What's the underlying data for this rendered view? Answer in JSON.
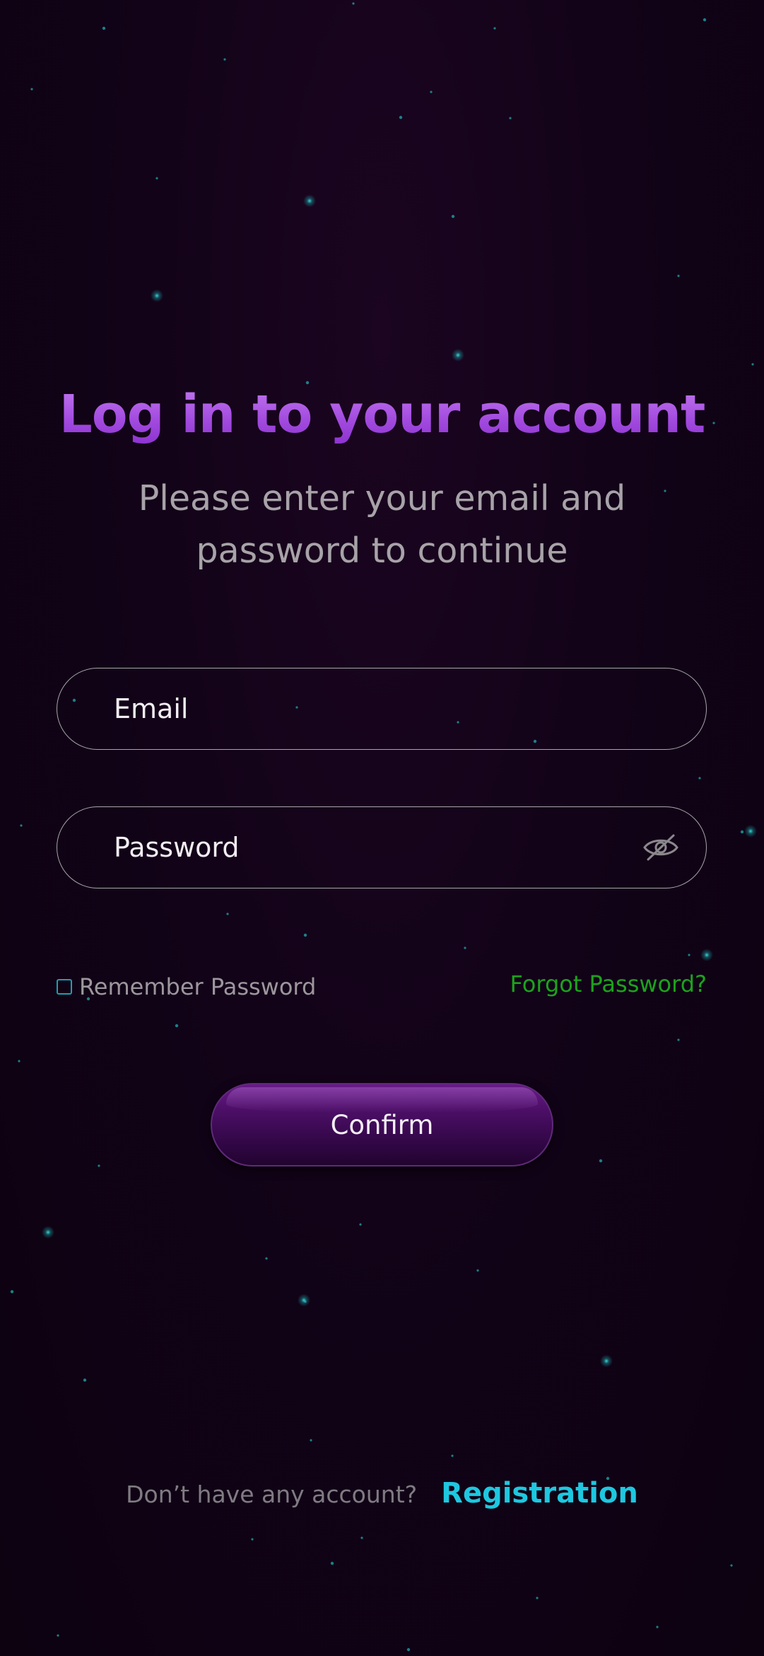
{
  "login": {
    "title": "Log in to your account",
    "subtitle": "Please enter your email and password to continue",
    "email_placeholder": "Email",
    "password_placeholder": "Password",
    "password_toggle_icon": "eye-off-icon",
    "remember_label": "Remember Password",
    "remember_checked": false,
    "forgot_label": "Forgot Password?",
    "confirm_label": "Confirm",
    "footer_prompt": "Don’t have any account?",
    "register_label": "Registration"
  },
  "colors": {
    "background": "#0e0212",
    "title_gradient_top": "#c77ef2",
    "title_gradient_bottom": "#8a2fcf",
    "forgot_link": "#1ca31c",
    "register_link": "#1ec7e0",
    "confirm_button": "#4d0f68",
    "star": "#1fc8c8"
  }
}
